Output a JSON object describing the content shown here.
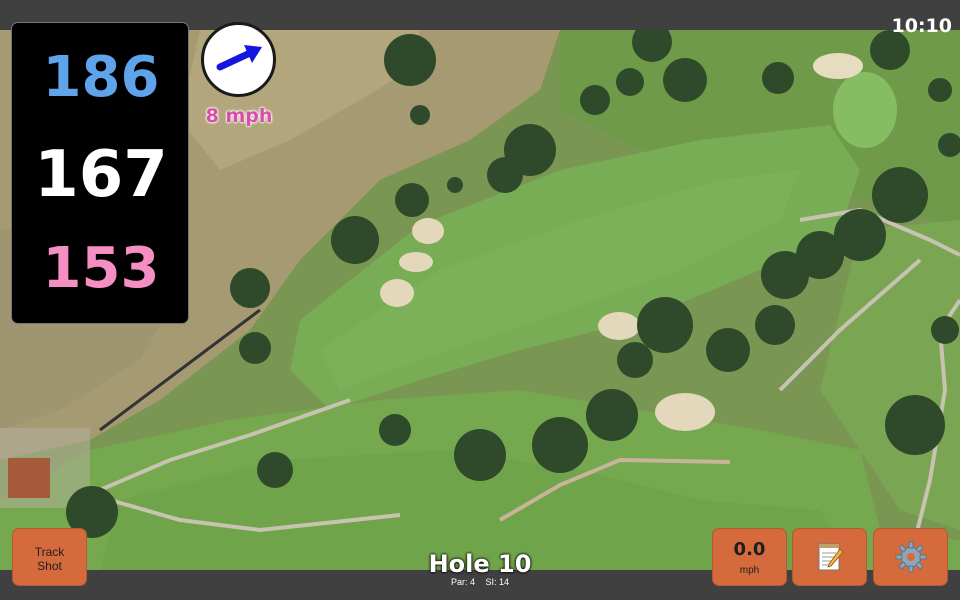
{
  "status": {
    "time": "10:10"
  },
  "distances": {
    "back": "186",
    "middle": "167",
    "front": "153"
  },
  "wind": {
    "speed_label": "8 mph",
    "direction_icon": "arrow-east-northeast"
  },
  "buttons": {
    "track_shot_line1": "Track",
    "track_shot_line2": "Shot",
    "speed_value": "0.0",
    "speed_unit": "mph",
    "notes_icon": "notepad-icon",
    "settings_icon": "gear-icon"
  },
  "hole": {
    "title": "Hole 10",
    "par": "Par: 4",
    "si": "SI: 14"
  },
  "colors": {
    "back_distance": "#5fa3ea",
    "middle_distance": "#ffffff",
    "front_distance": "#f48ec3",
    "wind_text": "#d64fa8",
    "button_bg": "#d56b3c"
  }
}
